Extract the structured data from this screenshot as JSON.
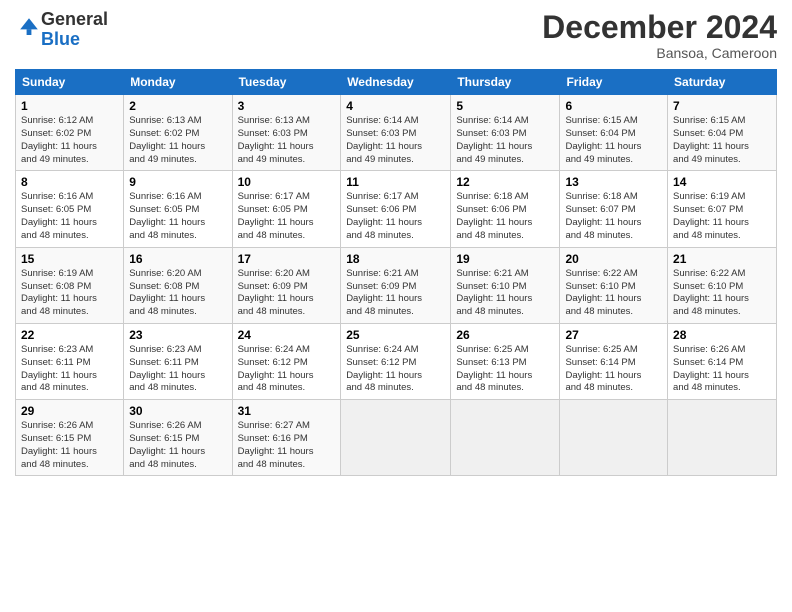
{
  "logo": {
    "general": "General",
    "blue": "Blue"
  },
  "title": "December 2024",
  "location": "Bansoa, Cameroon",
  "days_of_week": [
    "Sunday",
    "Monday",
    "Tuesday",
    "Wednesday",
    "Thursday",
    "Friday",
    "Saturday"
  ],
  "weeks": [
    [
      {
        "day": "1",
        "sunrise": "6:12 AM",
        "sunset": "6:02 PM",
        "daylight": "11 hours and 49 minutes."
      },
      {
        "day": "2",
        "sunrise": "6:13 AM",
        "sunset": "6:02 PM",
        "daylight": "11 hours and 49 minutes."
      },
      {
        "day": "3",
        "sunrise": "6:13 AM",
        "sunset": "6:03 PM",
        "daylight": "11 hours and 49 minutes."
      },
      {
        "day": "4",
        "sunrise": "6:14 AM",
        "sunset": "6:03 PM",
        "daylight": "11 hours and 49 minutes."
      },
      {
        "day": "5",
        "sunrise": "6:14 AM",
        "sunset": "6:03 PM",
        "daylight": "11 hours and 49 minutes."
      },
      {
        "day": "6",
        "sunrise": "6:15 AM",
        "sunset": "6:04 PM",
        "daylight": "11 hours and 49 minutes."
      },
      {
        "day": "7",
        "sunrise": "6:15 AM",
        "sunset": "6:04 PM",
        "daylight": "11 hours and 49 minutes."
      }
    ],
    [
      {
        "day": "8",
        "sunrise": "6:16 AM",
        "sunset": "6:05 PM",
        "daylight": "11 hours and 48 minutes."
      },
      {
        "day": "9",
        "sunrise": "6:16 AM",
        "sunset": "6:05 PM",
        "daylight": "11 hours and 48 minutes."
      },
      {
        "day": "10",
        "sunrise": "6:17 AM",
        "sunset": "6:05 PM",
        "daylight": "11 hours and 48 minutes."
      },
      {
        "day": "11",
        "sunrise": "6:17 AM",
        "sunset": "6:06 PM",
        "daylight": "11 hours and 48 minutes."
      },
      {
        "day": "12",
        "sunrise": "6:18 AM",
        "sunset": "6:06 PM",
        "daylight": "11 hours and 48 minutes."
      },
      {
        "day": "13",
        "sunrise": "6:18 AM",
        "sunset": "6:07 PM",
        "daylight": "11 hours and 48 minutes."
      },
      {
        "day": "14",
        "sunrise": "6:19 AM",
        "sunset": "6:07 PM",
        "daylight": "11 hours and 48 minutes."
      }
    ],
    [
      {
        "day": "15",
        "sunrise": "6:19 AM",
        "sunset": "6:08 PM",
        "daylight": "11 hours and 48 minutes."
      },
      {
        "day": "16",
        "sunrise": "6:20 AM",
        "sunset": "6:08 PM",
        "daylight": "11 hours and 48 minutes."
      },
      {
        "day": "17",
        "sunrise": "6:20 AM",
        "sunset": "6:09 PM",
        "daylight": "11 hours and 48 minutes."
      },
      {
        "day": "18",
        "sunrise": "6:21 AM",
        "sunset": "6:09 PM",
        "daylight": "11 hours and 48 minutes."
      },
      {
        "day": "19",
        "sunrise": "6:21 AM",
        "sunset": "6:10 PM",
        "daylight": "11 hours and 48 minutes."
      },
      {
        "day": "20",
        "sunrise": "6:22 AM",
        "sunset": "6:10 PM",
        "daylight": "11 hours and 48 minutes."
      },
      {
        "day": "21",
        "sunrise": "6:22 AM",
        "sunset": "6:10 PM",
        "daylight": "11 hours and 48 minutes."
      }
    ],
    [
      {
        "day": "22",
        "sunrise": "6:23 AM",
        "sunset": "6:11 PM",
        "daylight": "11 hours and 48 minutes."
      },
      {
        "day": "23",
        "sunrise": "6:23 AM",
        "sunset": "6:11 PM",
        "daylight": "11 hours and 48 minutes."
      },
      {
        "day": "24",
        "sunrise": "6:24 AM",
        "sunset": "6:12 PM",
        "daylight": "11 hours and 48 minutes."
      },
      {
        "day": "25",
        "sunrise": "6:24 AM",
        "sunset": "6:12 PM",
        "daylight": "11 hours and 48 minutes."
      },
      {
        "day": "26",
        "sunrise": "6:25 AM",
        "sunset": "6:13 PM",
        "daylight": "11 hours and 48 minutes."
      },
      {
        "day": "27",
        "sunrise": "6:25 AM",
        "sunset": "6:14 PM",
        "daylight": "11 hours and 48 minutes."
      },
      {
        "day": "28",
        "sunrise": "6:26 AM",
        "sunset": "6:14 PM",
        "daylight": "11 hours and 48 minutes."
      }
    ],
    [
      {
        "day": "29",
        "sunrise": "6:26 AM",
        "sunset": "6:15 PM",
        "daylight": "11 hours and 48 minutes."
      },
      {
        "day": "30",
        "sunrise": "6:26 AM",
        "sunset": "6:15 PM",
        "daylight": "11 hours and 48 minutes."
      },
      {
        "day": "31",
        "sunrise": "6:27 AM",
        "sunset": "6:16 PM",
        "daylight": "11 hours and 48 minutes."
      },
      null,
      null,
      null,
      null
    ]
  ],
  "labels": {
    "sunrise": "Sunrise:",
    "sunset": "Sunset:",
    "daylight": "Daylight:"
  }
}
